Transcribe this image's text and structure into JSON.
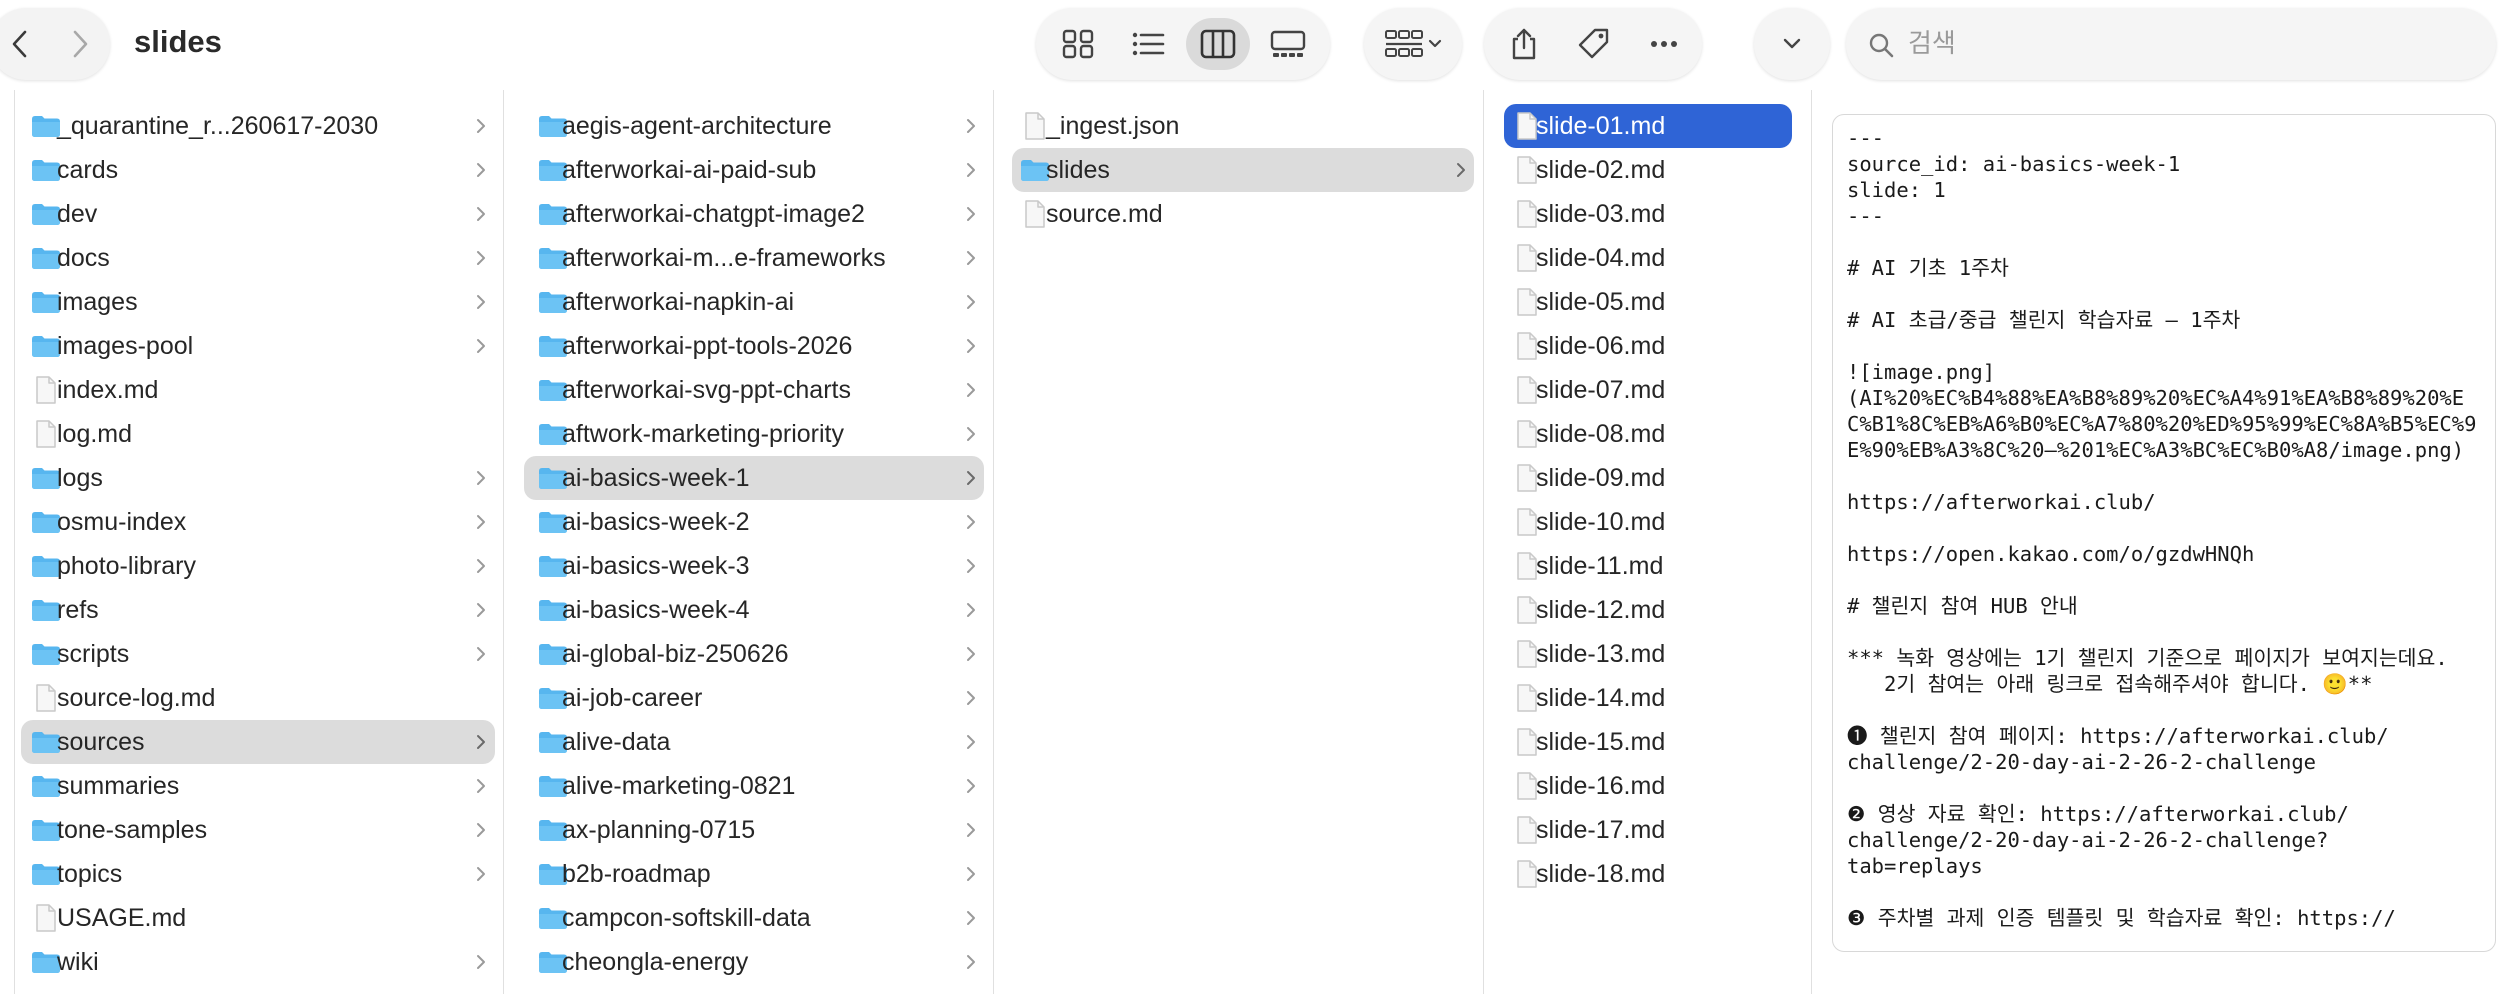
{
  "window": {
    "title": "slides"
  },
  "search": {
    "placeholder": "검색"
  },
  "icons": {
    "back": "chevron-left-icon",
    "forward": "chevron-right-icon",
    "view_icons": "grid-icon",
    "view_list": "list-icon",
    "view_columns": "columns-icon",
    "view_gallery": "gallery-icon",
    "group": "group-icon",
    "share": "share-icon",
    "tags": "tag-icon",
    "more": "ellipsis-icon",
    "search": "magnifier-icon"
  },
  "colors": {
    "folder": "#57b6ef",
    "selection_active": "#2f64d6",
    "selection_inactive": "#dcdcdc"
  },
  "columns": [
    {
      "items": [
        {
          "name": "_quarantine_r...260617-2030",
          "kind": "folder"
        },
        {
          "name": "cards",
          "kind": "folder"
        },
        {
          "name": "dev",
          "kind": "folder"
        },
        {
          "name": "docs",
          "kind": "folder"
        },
        {
          "name": "images",
          "kind": "folder"
        },
        {
          "name": "images-pool",
          "kind": "folder"
        },
        {
          "name": "index.md",
          "kind": "file"
        },
        {
          "name": "log.md",
          "kind": "file"
        },
        {
          "name": "logs",
          "kind": "folder"
        },
        {
          "name": "osmu-index",
          "kind": "folder"
        },
        {
          "name": "photo-library",
          "kind": "folder"
        },
        {
          "name": "refs",
          "kind": "folder"
        },
        {
          "name": "scripts",
          "kind": "folder"
        },
        {
          "name": "source-log.md",
          "kind": "file"
        },
        {
          "name": "sources",
          "kind": "folder",
          "state": "selected"
        },
        {
          "name": "summaries",
          "kind": "folder"
        },
        {
          "name": "tone-samples",
          "kind": "folder"
        },
        {
          "name": "topics",
          "kind": "folder"
        },
        {
          "name": "USAGE.md",
          "kind": "file"
        },
        {
          "name": "wiki",
          "kind": "folder"
        }
      ]
    },
    {
      "items": [
        {
          "name": "aegis-agent-architecture",
          "kind": "folder"
        },
        {
          "name": "afterworkai-ai-paid-sub",
          "kind": "folder"
        },
        {
          "name": "afterworkai-chatgpt-image2",
          "kind": "folder"
        },
        {
          "name": "afterworkai-m...e-frameworks",
          "kind": "folder"
        },
        {
          "name": "afterworkai-napkin-ai",
          "kind": "folder"
        },
        {
          "name": "afterworkai-ppt-tools-2026",
          "kind": "folder"
        },
        {
          "name": "afterworkai-svg-ppt-charts",
          "kind": "folder"
        },
        {
          "name": "aftwork-marketing-priority",
          "kind": "folder"
        },
        {
          "name": "ai-basics-week-1",
          "kind": "folder",
          "state": "selected"
        },
        {
          "name": "ai-basics-week-2",
          "kind": "folder"
        },
        {
          "name": "ai-basics-week-3",
          "kind": "folder"
        },
        {
          "name": "ai-basics-week-4",
          "kind": "folder"
        },
        {
          "name": "ai-global-biz-250626",
          "kind": "folder"
        },
        {
          "name": "ai-job-career",
          "kind": "folder"
        },
        {
          "name": "alive-data",
          "kind": "folder"
        },
        {
          "name": "alive-marketing-0821",
          "kind": "folder"
        },
        {
          "name": "ax-planning-0715",
          "kind": "folder"
        },
        {
          "name": "b2b-roadmap",
          "kind": "folder"
        },
        {
          "name": "campcon-softskill-data",
          "kind": "folder"
        },
        {
          "name": "cheongla-energy",
          "kind": "folder"
        }
      ]
    },
    {
      "items": [
        {
          "name": "_ingest.json",
          "kind": "file"
        },
        {
          "name": "slides",
          "kind": "folder",
          "state": "selected"
        },
        {
          "name": "source.md",
          "kind": "file"
        }
      ]
    },
    {
      "items": [
        {
          "name": "slide-01.md",
          "kind": "file",
          "state": "active"
        },
        {
          "name": "slide-02.md",
          "kind": "file"
        },
        {
          "name": "slide-03.md",
          "kind": "file"
        },
        {
          "name": "slide-04.md",
          "kind": "file"
        },
        {
          "name": "slide-05.md",
          "kind": "file"
        },
        {
          "name": "slide-06.md",
          "kind": "file"
        },
        {
          "name": "slide-07.md",
          "kind": "file"
        },
        {
          "name": "slide-08.md",
          "kind": "file"
        },
        {
          "name": "slide-09.md",
          "kind": "file"
        },
        {
          "name": "slide-10.md",
          "kind": "file"
        },
        {
          "name": "slide-11.md",
          "kind": "file"
        },
        {
          "name": "slide-12.md",
          "kind": "file"
        },
        {
          "name": "slide-13.md",
          "kind": "file"
        },
        {
          "name": "slide-14.md",
          "kind": "file"
        },
        {
          "name": "slide-15.md",
          "kind": "file"
        },
        {
          "name": "slide-16.md",
          "kind": "file"
        },
        {
          "name": "slide-17.md",
          "kind": "file"
        },
        {
          "name": "slide-18.md",
          "kind": "file"
        }
      ]
    }
  ],
  "preview": {
    "lines": [
      "---",
      "source_id: ai-basics-week-1",
      "slide: 1",
      "---",
      "",
      "# AI 기초 1주차",
      "",
      "# AI 초급/중급 챌린지 학습자료 – 1주차",
      "",
      "![image.png]",
      "(AI%20%EC%B4%88%EA%B8%89%20%EC%A4%91%EA%B8%89%20%EC%B1%8C%EB%A6%B0%EC%A7%80%20%ED%95%99%EC%8A%B5%EC%9E%90%EB%A3%8C%20–%201%EC%A3%BC%EC%B0%A8/image.png)",
      "",
      "https://afterworkai.club/",
      "",
      "https://open.kakao.com/o/gzdwHNQh",
      "",
      "# 챌린지 참여 HUB 안내",
      "",
      "*** 녹화 영상에는 1기 챌린지 기준으로 페이지가 보여지는데요.",
      "   2기 참여는 아래 링크로 접속해주셔야 합니다. 🙂**",
      "",
      "❶ 챌린지 참여 페이지: https://afterworkai.club/",
      "challenge/2-20-day-ai-2-26-2-challenge",
      "",
      "❷ 영상 자료 확인: https://afterworkai.club/",
      "challenge/2-20-day-ai-2-26-2-challenge?",
      "tab=replays",
      "",
      "❸ 주차별 과제 인증 템플릿 및 학습자료 확인: https://"
    ]
  }
}
